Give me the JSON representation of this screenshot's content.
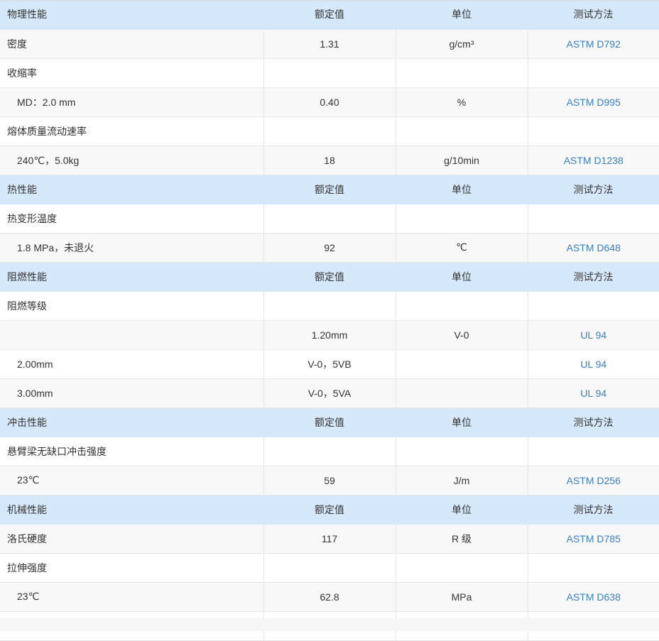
{
  "rows": [
    {
      "type": "header",
      "name": "物理性能",
      "value": "额定值",
      "unit": "单位",
      "method": "测试方法"
    },
    {
      "type": "row",
      "name": "密度",
      "value": "1.31",
      "unit": "g/cm³",
      "method": "ASTM D792"
    },
    {
      "type": "row",
      "name": "收缩率",
      "value": "",
      "unit": "",
      "method": ""
    },
    {
      "type": "row",
      "name": "MD：2.0 mm",
      "value": "0.40",
      "unit": "%",
      "method": "ASTM D995",
      "indent": true
    },
    {
      "type": "row",
      "name": "熔体质量流动速率",
      "value": "",
      "unit": "",
      "method": ""
    },
    {
      "type": "row",
      "name": "240℃，5.0kg",
      "value": "18",
      "unit": "g/10min",
      "method": "ASTM D1238",
      "indent": true
    },
    {
      "type": "header",
      "name": "热性能",
      "value": "额定值",
      "unit": "单位",
      "method": "测试方法"
    },
    {
      "type": "row",
      "name": "热变形温度",
      "value": "",
      "unit": "",
      "method": ""
    },
    {
      "type": "row",
      "name": "1.8 MPa，未退火",
      "value": "92",
      "unit": "℃",
      "method": "ASTM D648",
      "indent": true
    },
    {
      "type": "header",
      "name": "阻燃性能",
      "value": "额定值",
      "unit": "单位",
      "method": "测试方法"
    },
    {
      "type": "row",
      "name": "阻燃等级",
      "value": "",
      "unit": "",
      "method": ""
    },
    {
      "type": "row",
      "name": "",
      "value": "1.20mm",
      "unit": "V-0",
      "method": "UL 94"
    },
    {
      "type": "row",
      "name": "2.00mm",
      "value": "V-0，5VB",
      "unit": "",
      "method": "UL 94",
      "indent": true
    },
    {
      "type": "row",
      "name": "3.00mm",
      "value": "V-0，5VA",
      "unit": "",
      "method": "UL 94",
      "indent": true
    },
    {
      "type": "header",
      "name": "冲击性能",
      "value": "额定值",
      "unit": "单位",
      "method": "测试方法"
    },
    {
      "type": "row",
      "name": "悬臂梁无缺口冲击强度",
      "value": "",
      "unit": "",
      "method": ""
    },
    {
      "type": "row",
      "name": "23℃",
      "value": "59",
      "unit": "J/m",
      "method": "ASTM D256",
      "indent": true
    },
    {
      "type": "header",
      "name": "机械性能",
      "value": "额定值",
      "unit": "单位",
      "method": "测试方法"
    },
    {
      "type": "row",
      "name": "洛氏硬度",
      "value": "117",
      "unit": "R 级",
      "method": "ASTM D785"
    },
    {
      "type": "row",
      "name": "拉伸强度",
      "value": "",
      "unit": "",
      "method": ""
    },
    {
      "type": "row",
      "name": "23℃",
      "value": "62.8",
      "unit": "MPa",
      "method": "ASTM D638",
      "indent": true
    },
    {
      "type": "row",
      "name": "",
      "value": "",
      "unit": "",
      "method": ""
    }
  ]
}
